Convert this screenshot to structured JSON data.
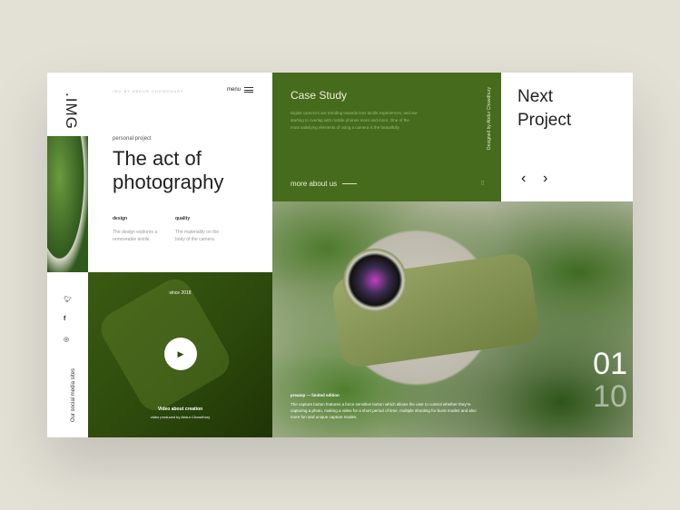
{
  "header": {
    "logo": ".IMG",
    "credit": "IMG BY ABDUR CHOWDHURY",
    "menu_label": "menu"
  },
  "intro": {
    "eyebrow": "personal project",
    "title": "The act of photography",
    "features": [
      {
        "label": "design",
        "text": "The design explores a removeable textile."
      },
      {
        "label": "quality",
        "text": "The materiality on the body of the camera."
      }
    ]
  },
  "social": {
    "icons": [
      "twitter-icon",
      "facebook-icon",
      "instagram-icon"
    ],
    "label": "Our social media sites"
  },
  "video": {
    "since": "since 2018",
    "title": "Video about creation",
    "subtitle": "video produced by Abdur Chowdhury"
  },
  "case_study": {
    "title": "Case Study",
    "text": "Digital camera's are trending towards less tactile experiences, and are starting to overlap with mobile phones more and more. One of the most satisfying elements of using a camera is the beautifully.",
    "link": "more about us",
    "designer": "Designed by Abdur Chowdhury"
  },
  "next": {
    "title": "Next Project",
    "prev": "‹",
    "next": "›"
  },
  "feature": {
    "title": "preamp — limited edition",
    "text": "The capture button features a force sensitive button which allows the user to control whether they're capturing a photo, making a video for a short period of time, multiple shooting for burst modes and also more fun and unique capture modes.",
    "current": "01",
    "total": "10"
  },
  "colors": {
    "accent": "#466b1d",
    "background": "#e3e0d6"
  }
}
